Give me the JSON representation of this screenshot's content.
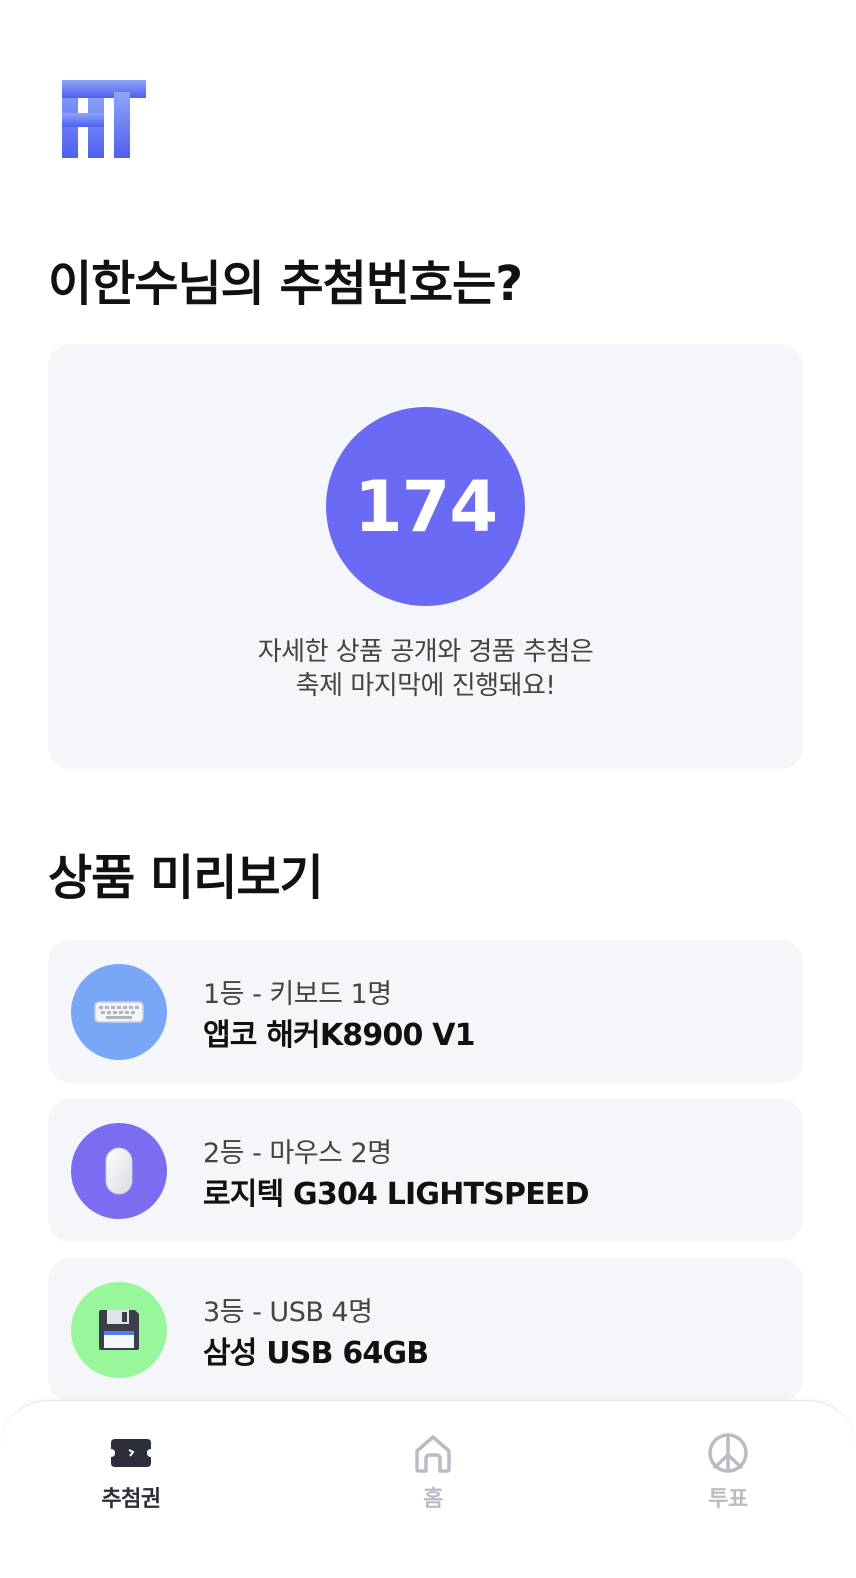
{
  "colors": {
    "accent": "#6b6af5",
    "logo_top": "#8ea6f7",
    "logo_bottom": "#4f5ff0",
    "card_bg": "#f5f6f9",
    "tab_active": "#2c2f3a",
    "tab_inactive": "#b8bcc4",
    "prize1_bg": "#7aa6f7",
    "prize2_bg": "#7b6cf2",
    "prize3_bg": "#98f79a"
  },
  "header": {
    "logo_icon": "ht-logo-icon"
  },
  "ticket": {
    "title": "이한수님의 추첨번호는?",
    "number": "174",
    "note_line1": "자세한 상품 공개와 경품 추첨은",
    "note_line2": "축제 마지막에 진행돼요!"
  },
  "prizes": {
    "title": "상품 미리보기",
    "items": [
      {
        "rank": "1등 - 키보드 1명",
        "name": "앱코 해커K8900 V1",
        "icon": "keyboard-icon"
      },
      {
        "rank": "2등 - 마우스 2명",
        "name": "로지텍 G304 LIGHTSPEED",
        "icon": "mouse-icon"
      },
      {
        "rank": "3등 - USB 4명",
        "name": "삼성 USB 64GB",
        "icon": "floppy-disk-icon"
      }
    ]
  },
  "tabbar": {
    "tabs": [
      {
        "label": "추첨권",
        "icon": "ticket-icon",
        "active": true
      },
      {
        "label": "홈",
        "icon": "home-icon",
        "active": false
      },
      {
        "label": "투표",
        "icon": "vote-icon",
        "active": false
      }
    ]
  }
}
